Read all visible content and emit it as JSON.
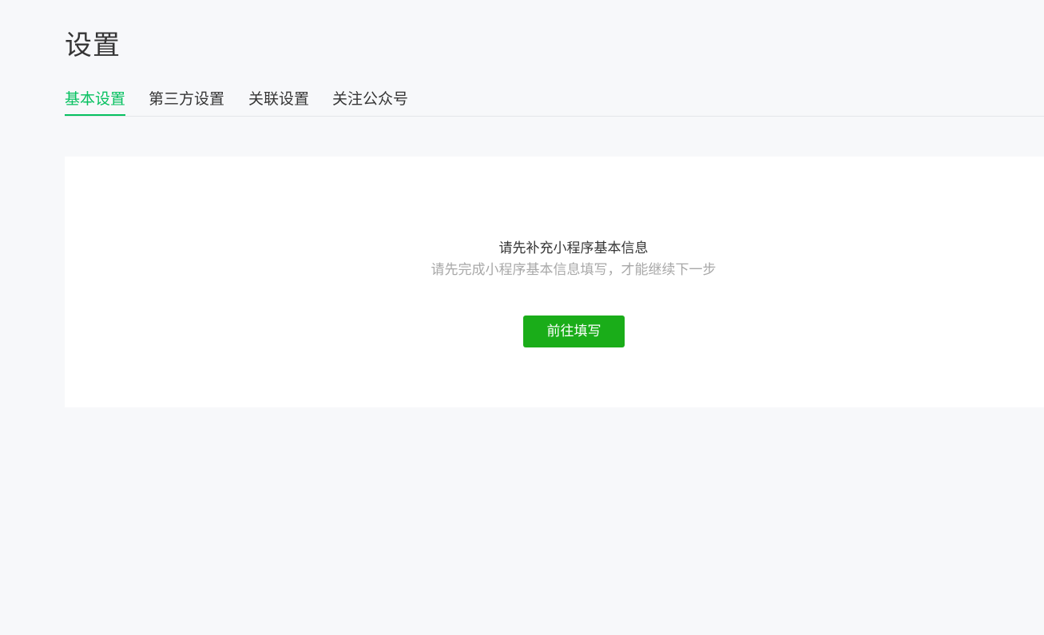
{
  "page": {
    "title": "设置"
  },
  "tabs": [
    {
      "label": "基本设置",
      "active": true
    },
    {
      "label": "第三方设置",
      "active": false
    },
    {
      "label": "关联设置",
      "active": false
    },
    {
      "label": "关注公众号",
      "active": false
    }
  ],
  "notice": {
    "title": "请先补充小程序基本信息",
    "description": "请先完成小程序基本信息填写，才能继续下一步",
    "button_label": "前往填写"
  },
  "colors": {
    "accent": "#07c160",
    "button": "#1aad19",
    "background": "#f7f8fa"
  }
}
